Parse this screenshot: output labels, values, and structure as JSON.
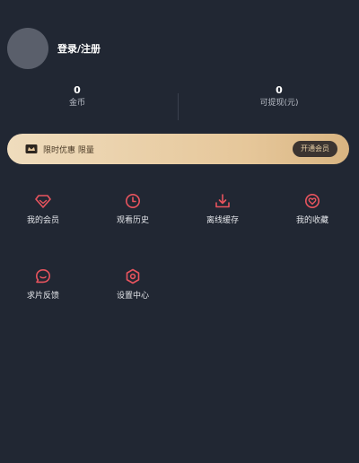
{
  "profile": {
    "login_label": "登录/注册"
  },
  "stats": {
    "coins_value": "0",
    "coins_label": "金币",
    "withdrawable_value": "0",
    "withdrawable_label": "可提现(元)"
  },
  "vip": {
    "text": "限时优惠 限量",
    "button_label": "开通会员"
  },
  "menu": {
    "items": [
      {
        "label": "我的会员",
        "icon": "diamond-icon"
      },
      {
        "label": "观看历史",
        "icon": "clock-icon"
      },
      {
        "label": "离线缓存",
        "icon": "download-icon"
      },
      {
        "label": "我的收藏",
        "icon": "heart-icon"
      },
      {
        "label": "求片反馈",
        "icon": "feedback-icon"
      },
      {
        "label": "设置中心",
        "icon": "settings-icon"
      }
    ]
  },
  "colors": {
    "background": "#212733",
    "accent": "#e8545e",
    "vip_gold": "#e6c79a"
  }
}
